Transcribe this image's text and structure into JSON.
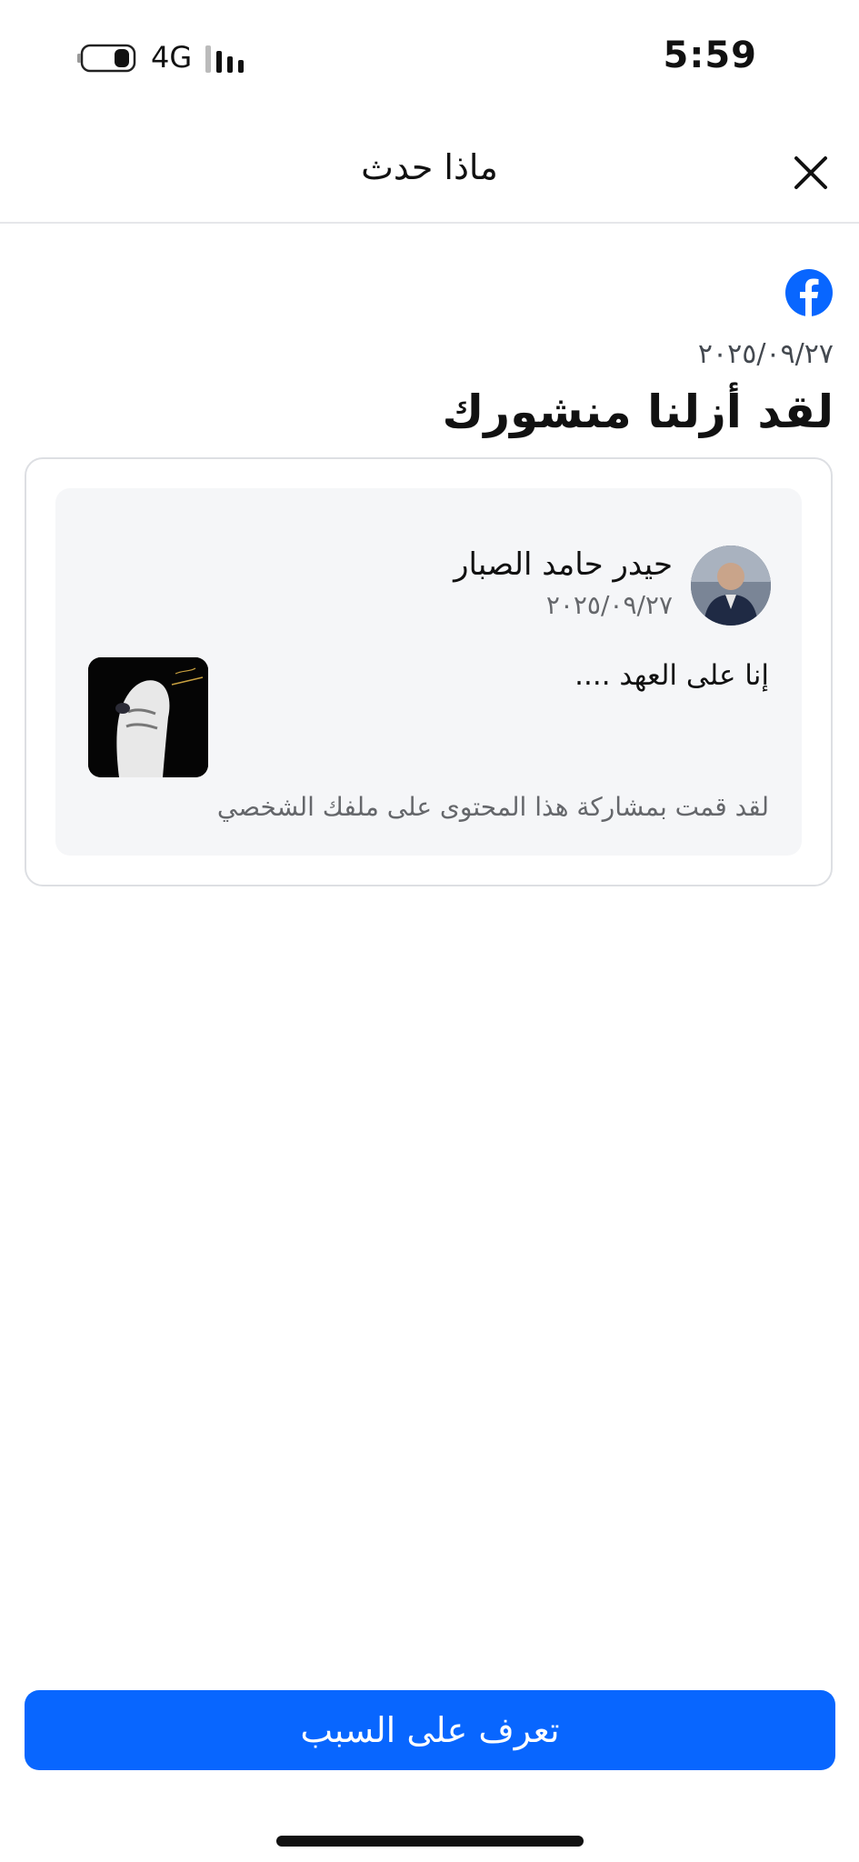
{
  "status_bar": {
    "network": "4G",
    "time": "5:59"
  },
  "header": {
    "title": "ماذا حدث",
    "close_icon": "close-icon"
  },
  "notice": {
    "logo_icon": "facebook-icon",
    "date": "٢٠٢٥/٠٩/٢٧",
    "title": "لقد أزلنا منشورك"
  },
  "post": {
    "author": "حيدر حامد الصبار",
    "date": "٢٠٢٥/٠٩/٢٧",
    "text": "إنا على العهد ....",
    "shared_note": "لقد قمت بمشاركة هذا المحتوى على ملفك الشخصي"
  },
  "cta": {
    "label": "تعرف على السبب"
  },
  "colors": {
    "accent": "#0866ff",
    "facebook_blue": "#0866ff",
    "card_bg": "#f5f6f8",
    "muted_text": "#65676b"
  }
}
